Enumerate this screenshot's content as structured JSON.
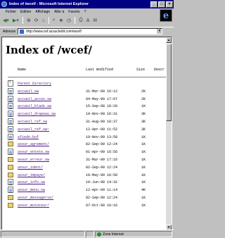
{
  "window": {
    "title": "Index of /wcef/ - Microsoft Internet Explorer"
  },
  "menu": [
    "Fichier",
    "Edition",
    "Affichage",
    "Aller à",
    "Favoris",
    "?"
  ],
  "toolbar": {
    "buttons": [
      "back",
      "forward",
      "stop",
      "refresh",
      "home",
      "search",
      "favorites",
      "print",
      "font",
      "mail"
    ]
  },
  "address": {
    "label": "Adresse",
    "url": "http://www.cef.acsucledit.com/wcef/"
  },
  "page": {
    "heading": "Index of /wcef/",
    "columns": {
      "name": "Name",
      "modified": "Last modified",
      "size": "Size",
      "desc": "Descr"
    },
    "entries": [
      {
        "type": "back",
        "name": "Parent Directory",
        "date": "",
        "size": ""
      },
      {
        "type": "file",
        "name": "accueil.sw",
        "date": "31-Mar-99 16:12",
        "size": "2K"
      },
      {
        "type": "file",
        "name": "accueil_acces.sw",
        "date": "04-May-99 17:07",
        "size": "2K"
      },
      {
        "type": "file",
        "name": "accueil_blank.sw",
        "date": "15-Sep-98 18:20",
        "size": "1K"
      },
      {
        "type": "file",
        "name": "accueil_drapeau.sw",
        "date": "19-Nov-99 16:31",
        "size": "3K"
      },
      {
        "type": "file",
        "name": "accueil_ref.sw",
        "date": "31-Aug-99 18:37",
        "size": "3K"
      },
      {
        "type": "file",
        "name": "accueil_ref.sw~",
        "date": "12-Apr-99 11:52",
        "size": "3K"
      },
      {
        "type": "file",
        "name": "afiedn.buf",
        "date": "19-Nov-99 13:58",
        "size": "1K"
      },
      {
        "type": "folder",
        "name": "assur_agrement/",
        "date": "02-Sep-99 12:24",
        "size": "1K"
      },
      {
        "type": "file",
        "name": "assur_entete.sw",
        "date": "01-Apr-99 16:56",
        "size": "1K"
      },
      {
        "type": "folder",
        "name": "assur_erreur.sw",
        "date": "31-Mar-99 17:16",
        "size": "1K"
      },
      {
        "type": "folder",
        "name": "assur_ident/",
        "date": "02-Sep-99 12:24",
        "size": "1K"
      },
      {
        "type": "folder",
        "name": "assur_impaye/",
        "date": "10-May-99 16:50",
        "size": "1K"
      },
      {
        "type": "file",
        "name": "assur_info.sw",
        "date": "19-Jun-98 14:32",
        "size": "1K"
      },
      {
        "type": "file",
        "name": "assur_menu.sw",
        "date": "12-Apr-99 11:14",
        "size": "4K"
      },
      {
        "type": "folder",
        "name": "assur_messagerie/",
        "date": "02-Sep-99 12:24",
        "size": "1K"
      },
      {
        "type": "folder",
        "name": "assur_mutateur/",
        "date": "07-Oct-99 10:16",
        "size": "1K"
      }
    ]
  },
  "status": {
    "text": "",
    "zone": "Zone Internet"
  }
}
